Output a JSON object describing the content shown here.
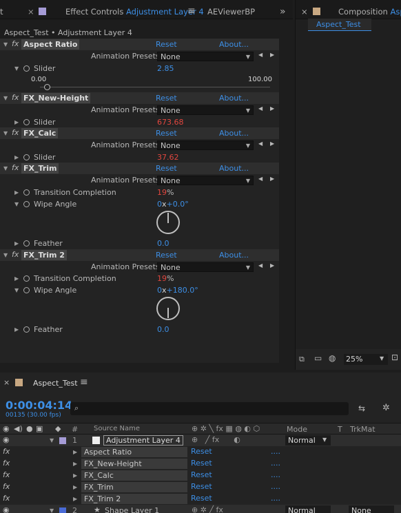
{
  "left_tabs": {
    "fragment": "t",
    "effect_controls": "Effect Controls",
    "layer_name": "Adjustment Layer 4",
    "aeviewer": "AEViewerBP",
    "overflow": "»"
  },
  "right_tabs": {
    "close": "×",
    "composition": "Composition",
    "comp_name_partial": "Aspe",
    "comp_tab": "Aspect_Test"
  },
  "ec_header": "Aspect_Test • Adjustment Layer 4",
  "labels": {
    "reset": "Reset",
    "about": "About...",
    "animation_presets": "Animation Presets:",
    "none": "None",
    "fx": "fx"
  },
  "effects": {
    "aspect_ratio": {
      "name": "Aspect Ratio",
      "slider_label": "Slider",
      "slider_value": "2.85",
      "range_min": "0.00",
      "range_max": "100.00",
      "slider_fraction": 0.0285
    },
    "fx_new_height": {
      "name": "FX_New-Height",
      "slider_label": "Slider",
      "slider_value": "673.68"
    },
    "fx_calc": {
      "name": "FX_Calc",
      "slider_label": "Slider",
      "slider_value": "37.62"
    },
    "fx_trim": {
      "name": "FX_Trim",
      "transition_label": "Transition Completion",
      "transition_value": "19",
      "percent": "%",
      "wipe_label": "Wipe Angle",
      "wipe_rev": "0",
      "wipe_x": "x",
      "wipe_deg": "+0.0°",
      "wipe_angle_deg": 0,
      "feather_label": "Feather",
      "feather_value": "0.0"
    },
    "fx_trim2": {
      "name": "FX_Trim 2",
      "transition_label": "Transition Completion",
      "transition_value": "19",
      "percent": "%",
      "wipe_label": "Wipe Angle",
      "wipe_rev": "0",
      "wipe_x": "x",
      "wipe_deg": "+180.0°",
      "wipe_angle_deg": 180,
      "feather_label": "Feather",
      "feather_value": "0.0"
    }
  },
  "viewer_bottom": {
    "zoom": "25%"
  },
  "timeline": {
    "tab": "Aspect_Test",
    "timecode": "0:00:04:14",
    "frames": "00135 (30.00 fps)",
    "search_placeholder": "",
    "columns": {
      "hash": "#",
      "source_name": "Source Name",
      "mode": "Mode",
      "t": "T",
      "trkmat": "TrkMat"
    },
    "layer1": {
      "num": "1",
      "name": "Adjustment Layer 4",
      "mode": "Normal"
    },
    "effects": [
      {
        "name": "Aspect Ratio",
        "reset": "Reset",
        "dots": "...."
      },
      {
        "name": "FX_New-Height",
        "reset": "Reset",
        "dots": "...."
      },
      {
        "name": "FX_Calc",
        "reset": "Reset",
        "dots": "...."
      },
      {
        "name": "FX_Trim",
        "reset": "Reset",
        "dots": "...."
      },
      {
        "name": "FX_Trim 2",
        "reset": "Reset",
        "dots": "...."
      }
    ],
    "layer2": {
      "num": "2",
      "name": "Shape Layer 1",
      "mode": "Normal",
      "trkmat": "None"
    }
  }
}
